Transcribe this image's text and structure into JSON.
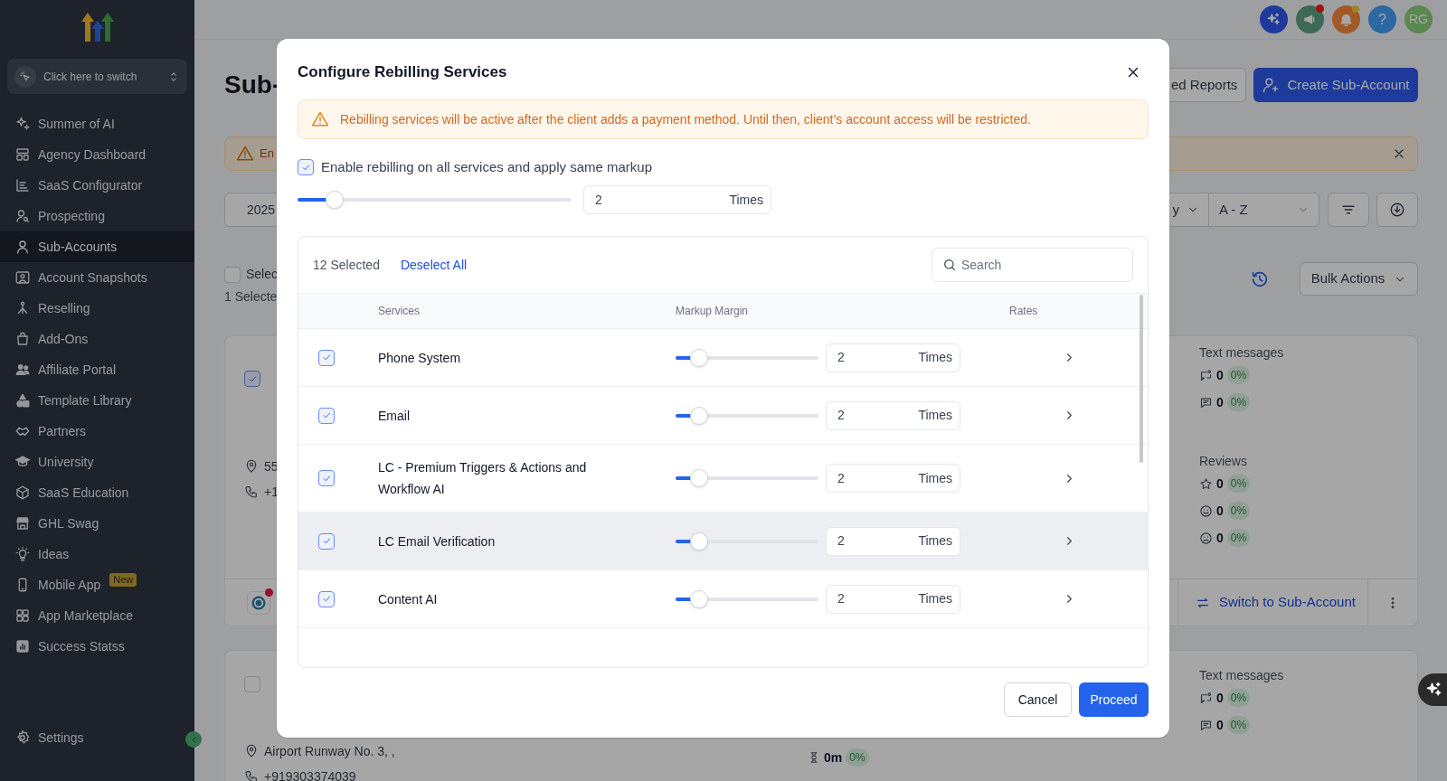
{
  "sidebar": {
    "switcher": {
      "label": "Click here to switch"
    },
    "items": [
      {
        "label": "Summer of AI",
        "selected": false
      },
      {
        "label": "Agency Dashboard",
        "selected": false
      },
      {
        "label": "SaaS Configurator",
        "selected": false
      },
      {
        "label": "Prospecting",
        "selected": false
      },
      {
        "label": "Sub-Accounts",
        "selected": true
      },
      {
        "label": "Account Snapshots",
        "selected": false
      },
      {
        "label": "Reselling",
        "selected": false
      },
      {
        "label": "Add-Ons",
        "selected": false
      },
      {
        "label": "Affiliate Portal",
        "selected": false
      },
      {
        "label": "Template Library",
        "selected": false
      },
      {
        "label": "Partners",
        "selected": false
      },
      {
        "label": "University",
        "selected": false
      },
      {
        "label": "SaaS Education",
        "selected": false
      },
      {
        "label": "GHL Swag",
        "selected": false
      },
      {
        "label": "Ideas",
        "selected": false
      },
      {
        "label": "Mobile App",
        "selected": false,
        "badge": "New"
      },
      {
        "label": "App Marketplace",
        "selected": false
      },
      {
        "label": "Success Statss",
        "selected": false
      }
    ],
    "footer_item": {
      "label": "Settings"
    }
  },
  "header": {
    "help_label": "?",
    "avatar_initials": "RG"
  },
  "page": {
    "title": "Sub-",
    "buttons": [
      {
        "label": "ed Reports",
        "kind": "secondary"
      },
      {
        "label": "Create Sub-Account",
        "kind": "primary"
      }
    ],
    "alert": {
      "text": "En"
    },
    "date_field": {
      "value": "2025"
    },
    "sort": {
      "group_by": "y",
      "order": "A - Z"
    },
    "select_all": {
      "label": "Selec",
      "checked": false
    },
    "selected_count": "1 Selecte",
    "bulk_actions": "Bulk Actions",
    "cards": [
      {
        "checked": true,
        "address": "55",
        "phone": "+1",
        "stats": [
          {
            "title": "Text messages",
            "rows": [
              {
                "kind": "sms-sent",
                "value": "0",
                "percent": "0%"
              },
              {
                "kind": "sms-received",
                "value": "0",
                "percent": "0%"
              }
            ]
          },
          {
            "title": "Reviews",
            "rows": [
              {
                "kind": "star",
                "value": "0",
                "percent": "0%"
              },
              {
                "kind": "happy",
                "value": "0",
                "percent": "0%"
              },
              {
                "kind": "sad",
                "value": "0",
                "percent": "0%"
              }
            ]
          }
        ],
        "switch_label": "Switch to Sub-Account"
      },
      {
        "checked": false,
        "address": "Airport Runway No. 3, ,",
        "phone": "+919303374039",
        "duration": {
          "value": "0m",
          "percent": "0%"
        },
        "stats": [
          {
            "title": "Text messages",
            "rows": [
              {
                "kind": "sms-sent",
                "value": "0",
                "percent": "0%"
              },
              {
                "kind": "sms-received",
                "value": "0",
                "percent": "0%"
              }
            ]
          }
        ]
      }
    ]
  },
  "modal": {
    "title": "Configure Rebilling Services",
    "notice": "Rebilling services will be active after the client adds a payment method. Until then, client’s account access will be restricted.",
    "apply_all": {
      "label": "Enable rebilling on all services and apply same markup",
      "checked": true
    },
    "global_markup": {
      "level": 0.13,
      "value": "2",
      "unit": "Times"
    },
    "selected_count": "12 Selected",
    "deselect_label": "Deselect All",
    "search": {
      "placeholder": "Search"
    },
    "columns": [
      "Services",
      "Markup Margin",
      "Rates"
    ],
    "services": [
      {
        "name": "Phone System",
        "checked": true,
        "level": 0.15,
        "value": "2",
        "unit": "Times",
        "hovered": false
      },
      {
        "name": "Email",
        "checked": true,
        "level": 0.15,
        "value": "2",
        "unit": "Times",
        "hovered": false
      },
      {
        "name": "LC - Premium Triggers & Actions and Workflow AI",
        "checked": true,
        "level": 0.15,
        "value": "2",
        "unit": "Times",
        "hovered": false
      },
      {
        "name": "LC Email Verification",
        "checked": true,
        "level": 0.15,
        "value": "2",
        "unit": "Times",
        "hovered": true
      },
      {
        "name": "Content AI",
        "checked": true,
        "level": 0.15,
        "value": "2",
        "unit": "Times",
        "hovered": false
      }
    ],
    "buttons": [
      {
        "label": "Cancel",
        "kind": "secondary"
      },
      {
        "label": "Proceed",
        "kind": "primary"
      }
    ]
  }
}
